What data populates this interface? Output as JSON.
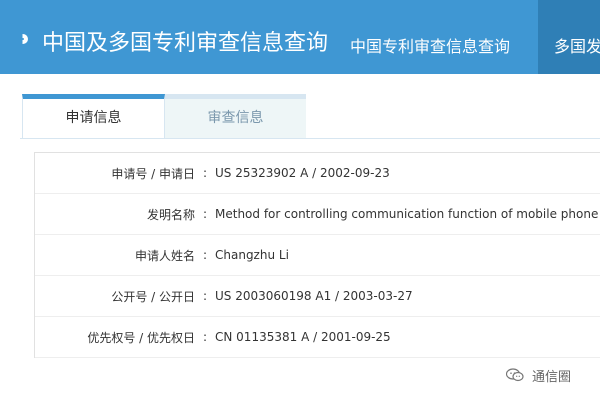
{
  "header": {
    "app_title": "中国及多国专利审查信息查询",
    "nav_links": [
      "中国专利审查信息查询",
      "多国发"
    ]
  },
  "tabs": [
    {
      "label": "申请信息",
      "active": true
    },
    {
      "label": "审查信息",
      "active": false
    }
  ],
  "fields": [
    {
      "label": "申请号 / 申请日",
      "value": "US 25323902 A / 2002-09-23"
    },
    {
      "label": "发明名称",
      "value": "Method for controlling communication function of mobile phone and m"
    },
    {
      "label": "申请人姓名",
      "value": "Changzhu Li"
    },
    {
      "label": "公开号 / 公开日",
      "value": "US 2003060198 A1 / 2003-03-27"
    },
    {
      "label": "优先权号 / 优先权日",
      "value": "CN 01135381 A / 2001-09-25"
    }
  ],
  "separator": ":",
  "watermark": {
    "text": "通信圈",
    "icon": "wechat-bubble-icon"
  },
  "colors": {
    "header_blue": "#3f97d3",
    "active_tab_border": "#3f97d3"
  }
}
